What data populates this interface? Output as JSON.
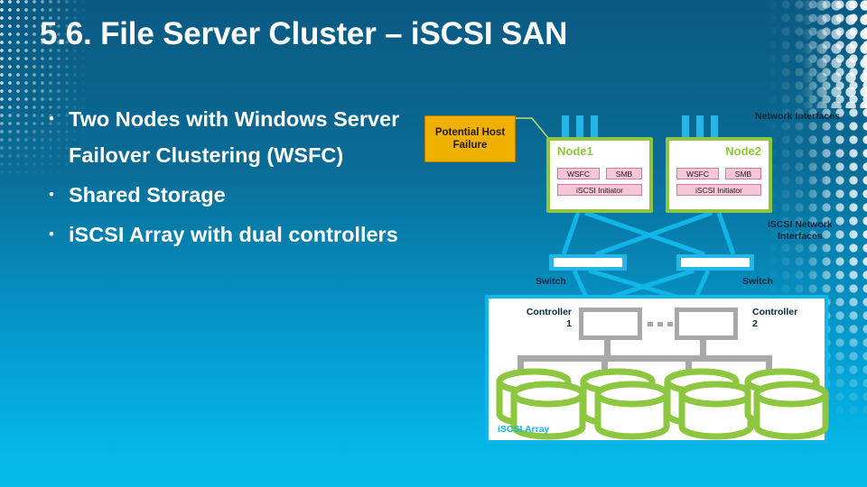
{
  "slide": {
    "title": "5.6. File Server Cluster – iSCSI SAN",
    "bullet_char": "•",
    "bullets": [
      "Two Nodes with Windows Server Failover Clustering (WSFC)",
      "Shared Storage",
      "iSCSI Array with dual controllers"
    ]
  },
  "callout": {
    "line1": "Potential Host",
    "line2": "Failure",
    "fill_color": "#f0b000",
    "text_color": "#1a1a1a"
  },
  "diagram": {
    "labels": {
      "network_interfaces": "Network Interfaces",
      "iscsi_network_interfaces_line1": "iSCSI Network",
      "iscsi_network_interfaces_line2": "Interfaces",
      "switch1": "Switch",
      "switch2": "Switch",
      "controller1_line1": "Controller",
      "controller1_line2": "1",
      "controller2_line1": "Controller",
      "controller2_line2": "2",
      "array": "iSCSI Array"
    },
    "nodes": [
      {
        "name": "Node1",
        "services": [
          "WSFC",
          "SMB"
        ],
        "initiator": "iSCSI Initiator",
        "nic_count": 3
      },
      {
        "name": "Node2",
        "services": [
          "WSFC",
          "SMB"
        ],
        "initiator": "iSCSI Initiator",
        "nic_count": 3
      }
    ],
    "disk_group_count": 4,
    "colors": {
      "node_border": "#8dc63f",
      "chip_fill": "#f6c6d8",
      "chip_border": "#d4789e",
      "link": "#12b5e8",
      "switch": "#25b6e8",
      "array_border": "#12b5e8",
      "disk": "#8dc63f",
      "controller": "#a8a8a8",
      "background_top": "#0a5a84",
      "background_bottom": "#06bbe8"
    }
  }
}
